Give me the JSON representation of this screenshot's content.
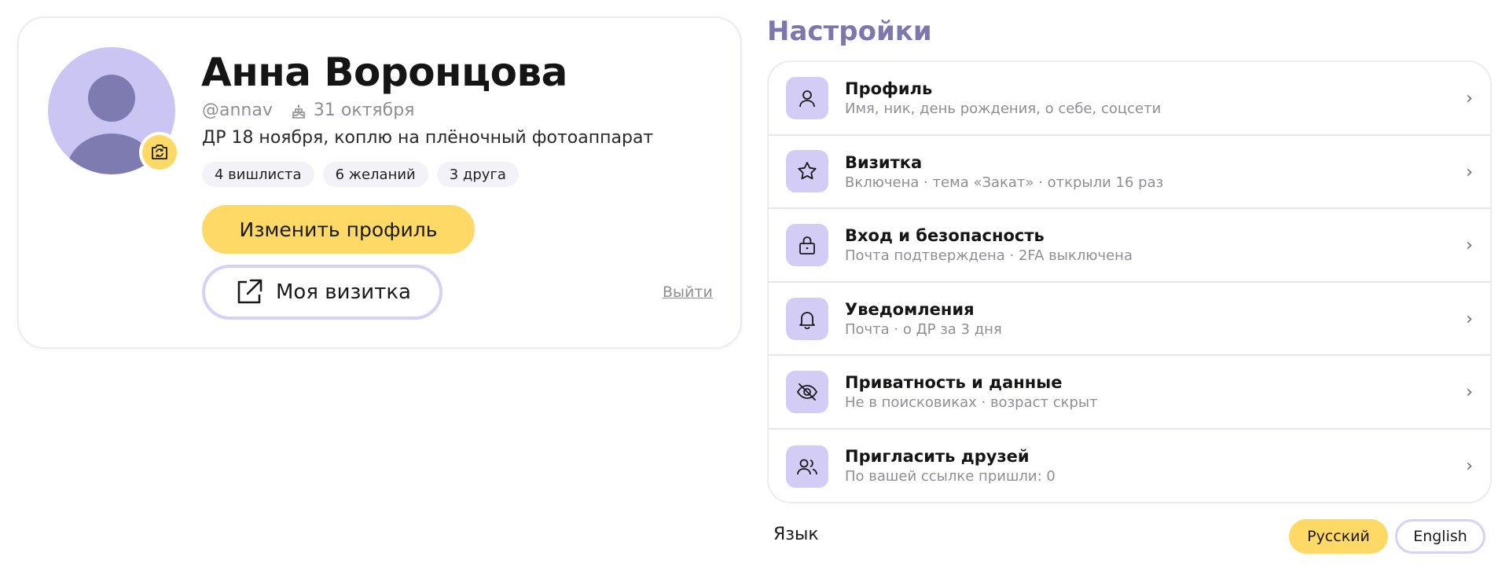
{
  "profile": {
    "name": "Анна Воронцова",
    "username": "@annav",
    "birthday": "31 октября",
    "status": "ДР 18 ноября, коплю на плёночный фотоаппарат",
    "chips": [
      "4 вишлиста",
      "6 желаний",
      "3 друга"
    ],
    "edit_button": "Изменить профиль",
    "card_button": "Моя визитка",
    "logout": "Выйти",
    "avatar_icon": "camera-change-icon"
  },
  "settings": {
    "title": "Настройки",
    "items": [
      {
        "title": "Профиль",
        "subtitle": "Имя, ник, день рождения, о себе, соцсети",
        "icon": "user-icon"
      },
      {
        "title": "Визитка",
        "subtitle": "Включена · тема «Закат» · открыли 16 раз",
        "icon": "star-icon"
      },
      {
        "title": "Вход и безопасность",
        "subtitle": "Почта подтверждена · 2FA выключена",
        "icon": "lock-icon"
      },
      {
        "title": "Уведомления",
        "subtitle": "Почта · о ДР за 3 дня",
        "icon": "bell-icon"
      },
      {
        "title": "Приватность и данные",
        "subtitle": "Не в поисковиках · возраст скрыт",
        "icon": "eye-off-icon"
      },
      {
        "title": "Пригласить друзей",
        "subtitle": "По вашей ссылке пришли: 0",
        "icon": "users-icon"
      }
    ],
    "chevron": "›"
  },
  "language": {
    "label": "Язык",
    "options": [
      "Русский",
      "English"
    ],
    "selected": "Русский"
  },
  "colors": {
    "accent_yellow": "#ffd966",
    "accent_lavender": "#d3cdf6",
    "title_purple": "#7c78ad"
  }
}
